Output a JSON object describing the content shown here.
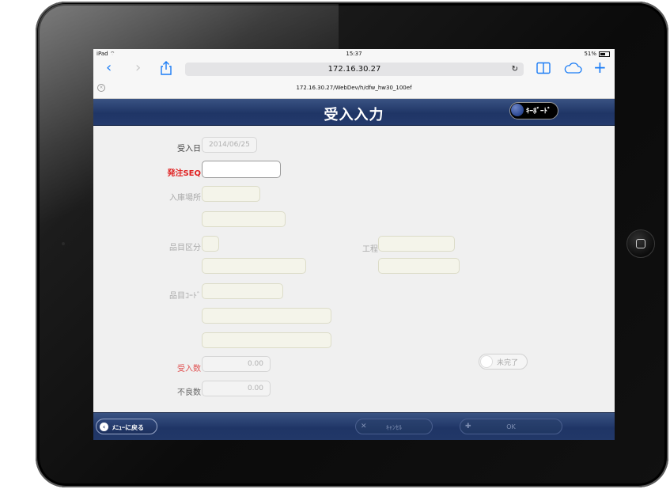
{
  "status": {
    "device": "iPad",
    "time": "15:37",
    "battery": "51%"
  },
  "safari": {
    "url": "172.16.30.27",
    "tab_url": "172.16.30.27/WebDev/h/dfw_hw30_100ef"
  },
  "header": {
    "title": "受入入力",
    "keyboard_label": "ｷｰﾎﾞｰﾄﾞ"
  },
  "form": {
    "receipt_date": {
      "label": "受入日",
      "value": "2014/06/25"
    },
    "order_seq": {
      "label": "発注SEQ",
      "value": ""
    },
    "location": {
      "label": "入庫場所"
    },
    "item_category": {
      "label": "品目区分"
    },
    "process": {
      "label": "工程"
    },
    "item_code": {
      "label": "品目ｺｰﾄﾞ"
    },
    "receipt_qty": {
      "label": "受入数",
      "value": "0.00"
    },
    "defect_qty": {
      "label": "不良数",
      "value": "0.00"
    },
    "incomplete_toggle": {
      "label": "未完了"
    }
  },
  "footer": {
    "menu_label": "ﾒﾆｭｰに戻る",
    "cancel_label": "ｷｬﾝｾﾙ",
    "ok_label": "OK"
  },
  "colors": {
    "header_blue": "#1f3566",
    "required_red": "#e02020",
    "link_blue": "#1a7cf5"
  }
}
